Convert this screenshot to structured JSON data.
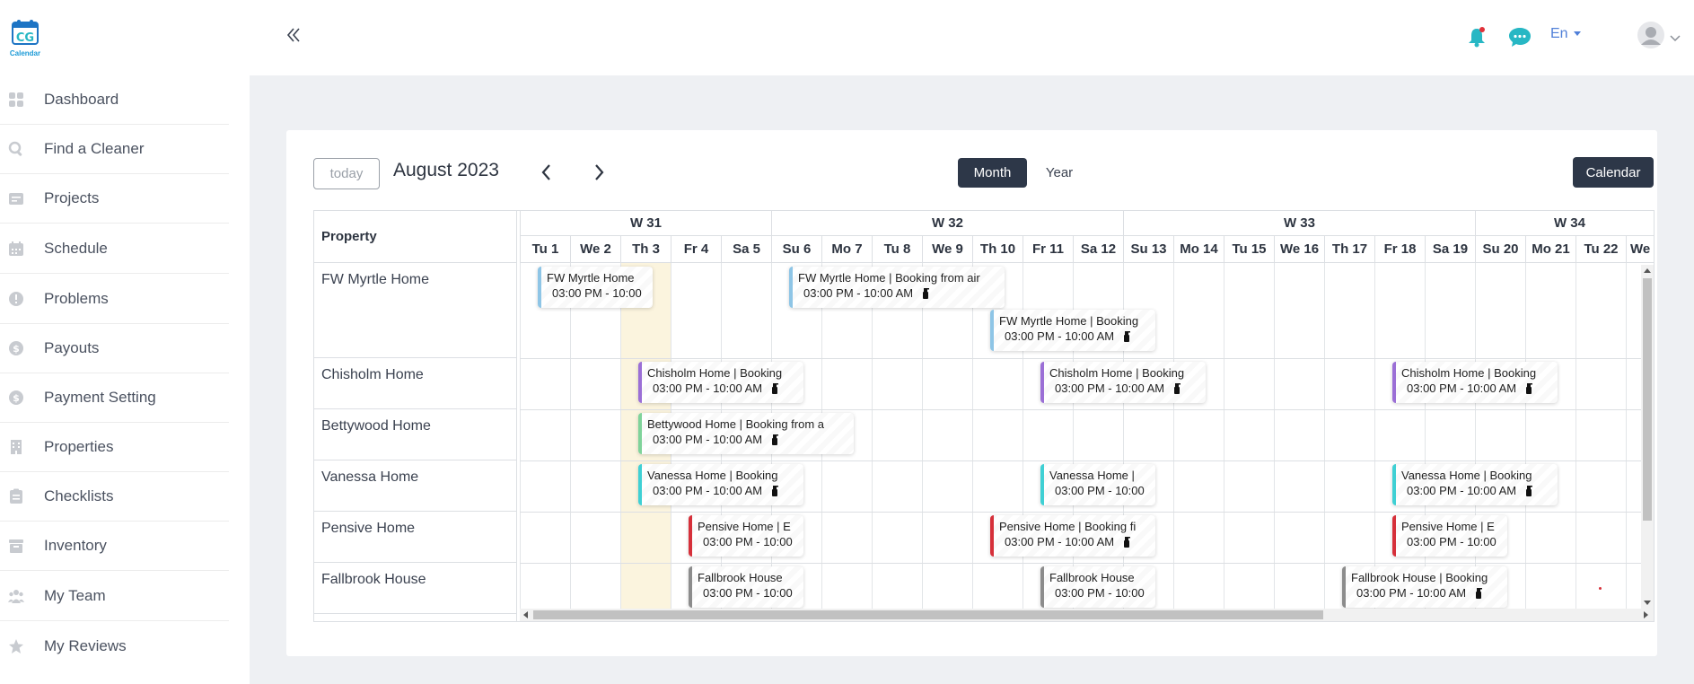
{
  "app": {
    "logo_text": "Calendar"
  },
  "sidebar": {
    "items": [
      {
        "label": "Dashboard",
        "icon": "dashboard-icon"
      },
      {
        "label": "Find a Cleaner",
        "icon": "search-icon"
      },
      {
        "label": "Projects",
        "icon": "projects-icon"
      },
      {
        "label": "Schedule",
        "icon": "calendar-icon"
      },
      {
        "label": "Problems",
        "icon": "alert-icon"
      },
      {
        "label": "Payouts",
        "icon": "dollar-icon"
      },
      {
        "label": "Payment Setting",
        "icon": "dollar-icon"
      },
      {
        "label": "Properties",
        "icon": "building-icon"
      },
      {
        "label": "Checklists",
        "icon": "checklist-icon"
      },
      {
        "label": "Inventory",
        "icon": "archive-icon"
      },
      {
        "label": "My Team",
        "icon": "team-icon"
      },
      {
        "label": "My Reviews",
        "icon": "star-icon"
      }
    ]
  },
  "topbar": {
    "language": "En"
  },
  "toolbar": {
    "today_label": "today",
    "period_title": "August 2023",
    "month_label": "Month",
    "year_label": "Year",
    "calendar_label": "Calendar"
  },
  "grid": {
    "property_header": "Property",
    "weeks": [
      "W 31",
      "W 32",
      "W 33",
      "W 34"
    ],
    "days": [
      "Tu 1",
      "We 2",
      "Th 3",
      "Fr 4",
      "Sa 5",
      "Su 6",
      "Mo 7",
      "Tu 8",
      "We 9",
      "Th 10",
      "Fr 11",
      "Sa 12",
      "Su 13",
      "Mo 14",
      "Tu 15",
      "We 16",
      "Th 17",
      "Fr 18",
      "Sa 19",
      "Su 20",
      "Mo 21",
      "Tu 22",
      "We"
    ],
    "properties": [
      "FW Myrtle Home",
      "Chisholm Home",
      "Bettywood Home",
      "Vanessa Home",
      "Pensive Home",
      "Fallbrook House"
    ],
    "events": [
      {
        "title": "FW Myrtle Home",
        "time": "03:00 PM - 10:00"
      },
      {
        "title": "FW Myrtle Home | Booking from air",
        "time": "03:00 PM - 10:00 AM"
      },
      {
        "title": "FW Myrtle Home | Booking",
        "time": "03:00 PM - 10:00 AM"
      },
      {
        "title": "Chisholm Home | Booking",
        "time": "03:00 PM - 10:00 AM"
      },
      {
        "title": "Chisholm Home | Booking",
        "time": "03:00 PM - 10:00 AM"
      },
      {
        "title": "Chisholm Home | Booking",
        "time": "03:00 PM - 10:00 AM"
      },
      {
        "title": "Bettywood Home | Booking from a",
        "time": "03:00 PM - 10:00 AM"
      },
      {
        "title": "Vanessa Home | Booking",
        "time": "03:00 PM - 10:00 AM"
      },
      {
        "title": "Vanessa Home |",
        "time": "03:00 PM - 10:00"
      },
      {
        "title": "Vanessa Home | Booking",
        "time": "03:00 PM - 10:00 AM"
      },
      {
        "title": "Pensive Home | E",
        "time": "03:00 PM - 10:00"
      },
      {
        "title": "Pensive Home | Booking fi",
        "time": "03:00 PM - 10:00 AM"
      },
      {
        "title": "Pensive Home | E",
        "time": "03:00 PM - 10:00"
      },
      {
        "title": "Fallbrook House",
        "time": "03:00 PM - 10:00"
      },
      {
        "title": "Fallbrook House",
        "time": "03:00 PM - 10:00"
      },
      {
        "title": "Fallbrook House | Booking",
        "time": "03:00 PM - 10:00 AM"
      }
    ]
  },
  "colors": {
    "primary_dark": "#2d3748",
    "accent_teal": "#27b7c4",
    "today_highlight": "#fbf4de",
    "myrtle": "#8ec5e6",
    "chisholm": "#9b6fd6",
    "bettywood": "#7fd39a",
    "vanessa": "#3fd0d4",
    "pensive": "#d6303a",
    "fallbrook": "#8c8c8c"
  }
}
